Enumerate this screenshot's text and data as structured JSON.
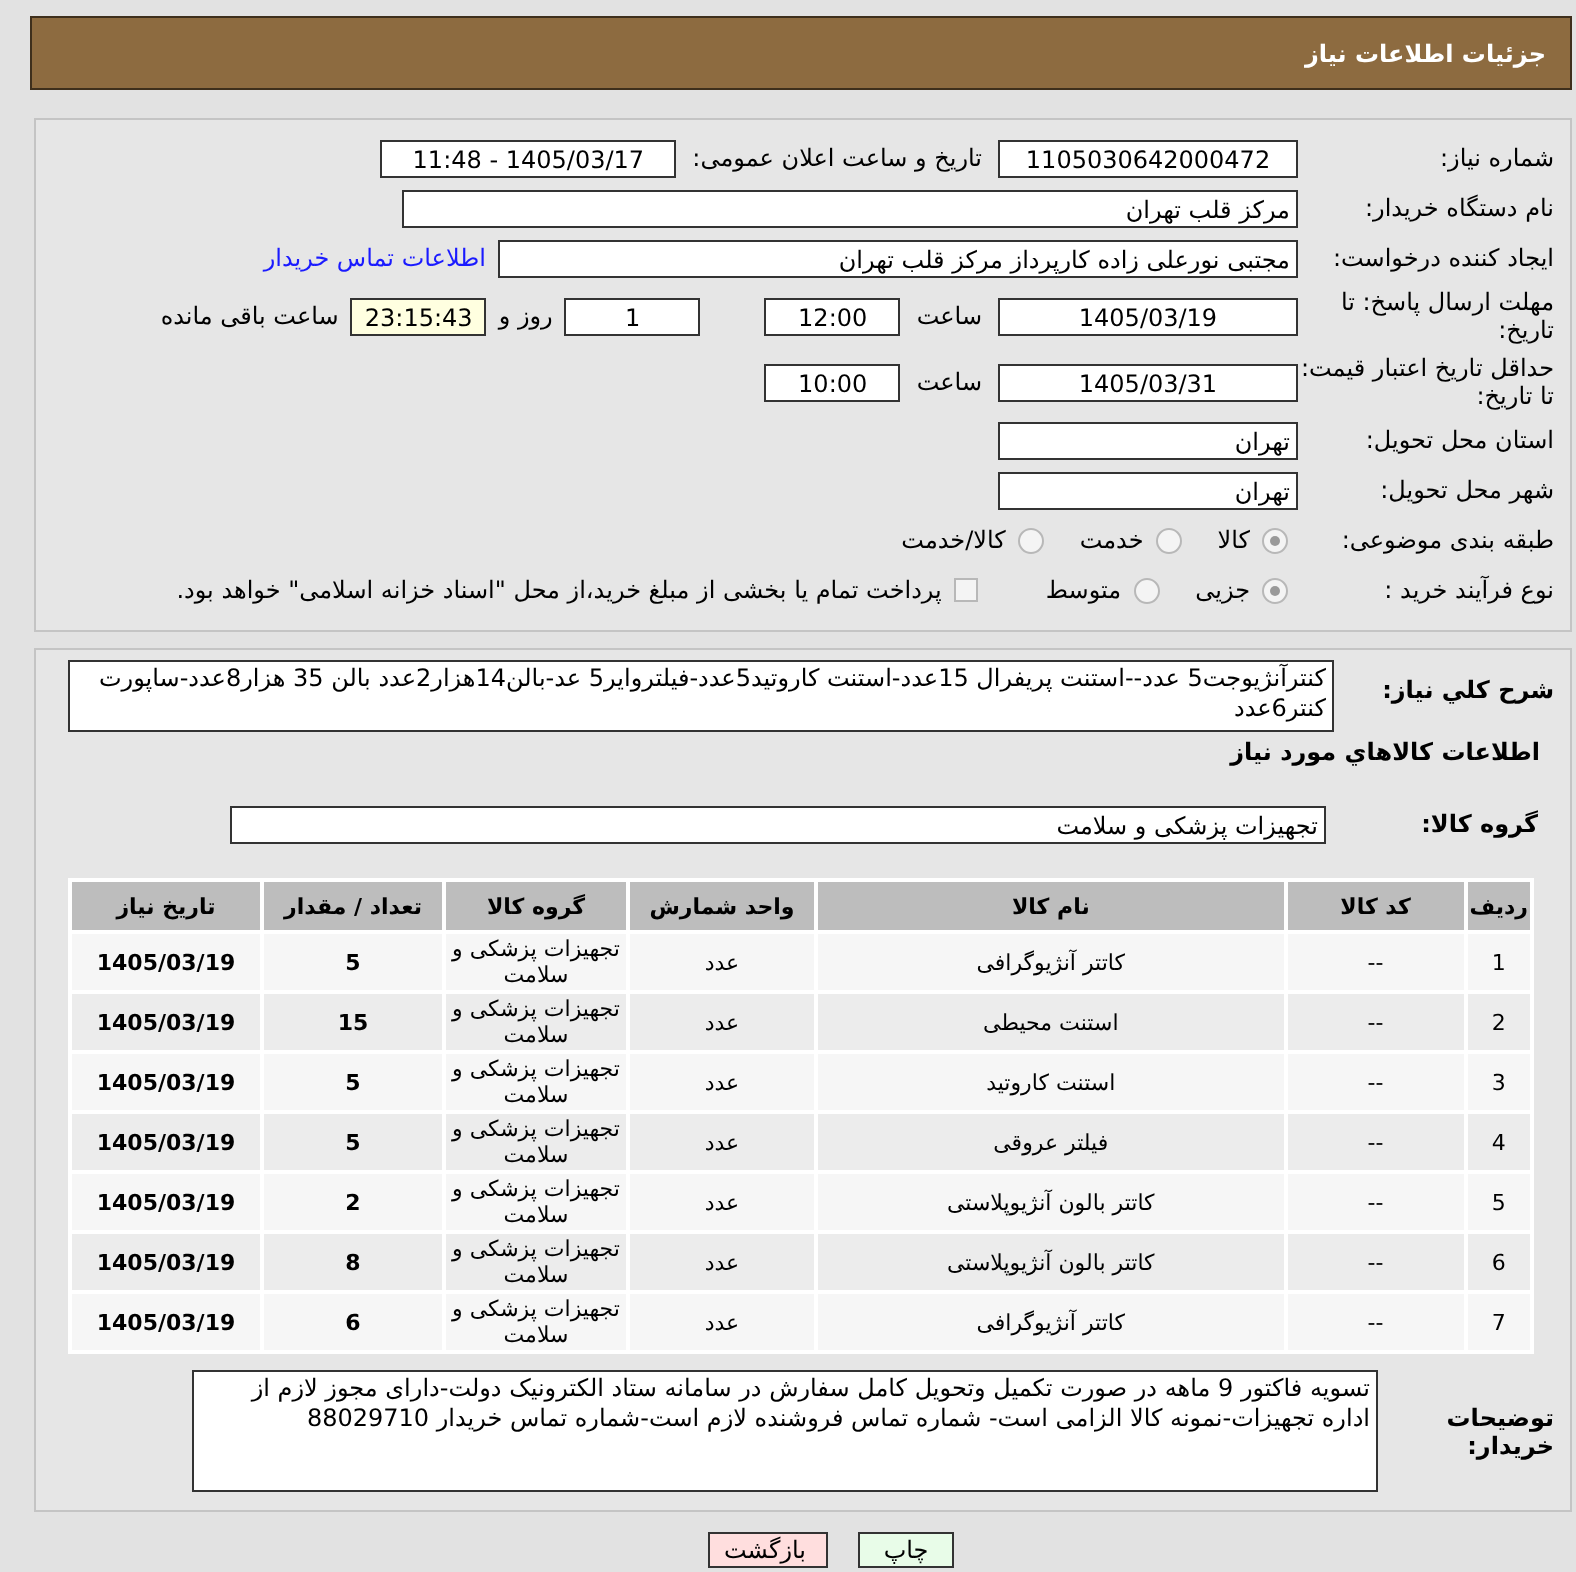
{
  "header": {
    "title": "جزئیات اطلاعات نیاز"
  },
  "need_number": {
    "label": "شماره نیاز:",
    "value": "1105030642000472"
  },
  "announce": {
    "label": "تاریخ و ساعت اعلان عمومی:",
    "value": "1405/03/17 - 11:48"
  },
  "buyer_org": {
    "label": "نام دستگاه خریدار:",
    "value": "مرکز قلب تهران"
  },
  "requester": {
    "label": "ایجاد کننده درخواست:",
    "value": "مجتبی نورعلی زاده کارپرداز مرکز قلب تهران",
    "link": "اطلاعات تماس خریدار"
  },
  "deadline": {
    "label": "مهلت ارسال پاسخ: تا تاریخ:",
    "date": "1405/03/19",
    "time_label": "ساعت",
    "time": "12:00",
    "days": "1",
    "days_label": "روز و",
    "remaining": "23:15:43",
    "remaining_label": "ساعت باقی مانده"
  },
  "price_validity": {
    "label": "حداقل تاریخ اعتبار قیمت: تا تاریخ:",
    "date": "1405/03/31",
    "time_label": "ساعت",
    "time": "10:00"
  },
  "province": {
    "label": "استان محل تحویل:",
    "value": "تهران"
  },
  "city": {
    "label": "شهر محل تحویل:",
    "value": "تهران"
  },
  "category": {
    "label": "طبقه بندی موضوعی:",
    "options": [
      {
        "label": "کالا",
        "selected": true
      },
      {
        "label": "خدمت",
        "selected": false
      },
      {
        "label": "کالا/خدمت",
        "selected": false
      }
    ]
  },
  "purchase_type": {
    "label": "نوع فرآیند خرید :",
    "options": [
      {
        "label": "جزیی",
        "selected": true
      },
      {
        "label": "متوسط",
        "selected": false
      }
    ],
    "treasury": {
      "checked": false,
      "text": "پرداخت تمام یا بخشی از مبلغ خرید،از محل \"اسناد خزانه اسلامی\" خواهد بود."
    }
  },
  "description": {
    "label": "شرح کلي نیاز:",
    "value": "کنترآنژیوجت5 عدد--استنت پریفرال 15عدد-استنت کاروتید5عدد-فیلتروایر5 عد-بالن14هزار2عدد بالن 35 هزار8عدد-ساپورت کنتر6عدد"
  },
  "goods_section": {
    "title": "اطلاعات کالاهاي مورد نياز"
  },
  "goods_group": {
    "label": "گروه کالا:",
    "value": "تجهیزات پزشکی و سلامت"
  },
  "table": {
    "columns": [
      "ردیف",
      "کد کالا",
      "نام کالا",
      "واحد شمارش",
      "گروه کالا",
      "تعداد / مقدار",
      "تاریخ نیاز"
    ],
    "rows": [
      [
        "1",
        "--",
        "کاتتر آنژیوگرافی",
        "عدد",
        "تجهیزات پزشکی و سلامت",
        "5",
        "1405/03/19"
      ],
      [
        "2",
        "--",
        "استنت محیطی",
        "عدد",
        "تجهیزات پزشکی و سلامت",
        "15",
        "1405/03/19"
      ],
      [
        "3",
        "--",
        "استنت کاروتید",
        "عدد",
        "تجهیزات پزشکی و سلامت",
        "5",
        "1405/03/19"
      ],
      [
        "4",
        "--",
        "فیلتر عروقی",
        "عدد",
        "تجهیزات پزشکی و سلامت",
        "5",
        "1405/03/19"
      ],
      [
        "5",
        "--",
        "کاتتر بالون آنژیوپلاستی",
        "عدد",
        "تجهیزات پزشکی و سلامت",
        "2",
        "1405/03/19"
      ],
      [
        "6",
        "--",
        "کاتتر بالون آنژیوپلاستی",
        "عدد",
        "تجهیزات پزشکی و سلامت",
        "8",
        "1405/03/19"
      ],
      [
        "7",
        "--",
        "کاتتر آنژیوگرافی",
        "عدد",
        "تجهیزات پزشکی و سلامت",
        "6",
        "1405/03/19"
      ]
    ]
  },
  "buyer_notes": {
    "label": "توضیحات خریدار:",
    "value": "تسویه فاکتور 9 ماهه در صورت تکمیل وتحویل کامل سفارش در سامانه  ستاد الکترونیک دولت-دارای مجوز لازم از اداره تجهیزات-نمونه کالا الزامی است- شماره تماس فروشنده لازم است-شماره تماس خریدار 88029710"
  },
  "buttons": [
    {
      "label": "چاپ",
      "kind": "print"
    },
    {
      "label": "بازگشت",
      "kind": "back"
    }
  ]
}
